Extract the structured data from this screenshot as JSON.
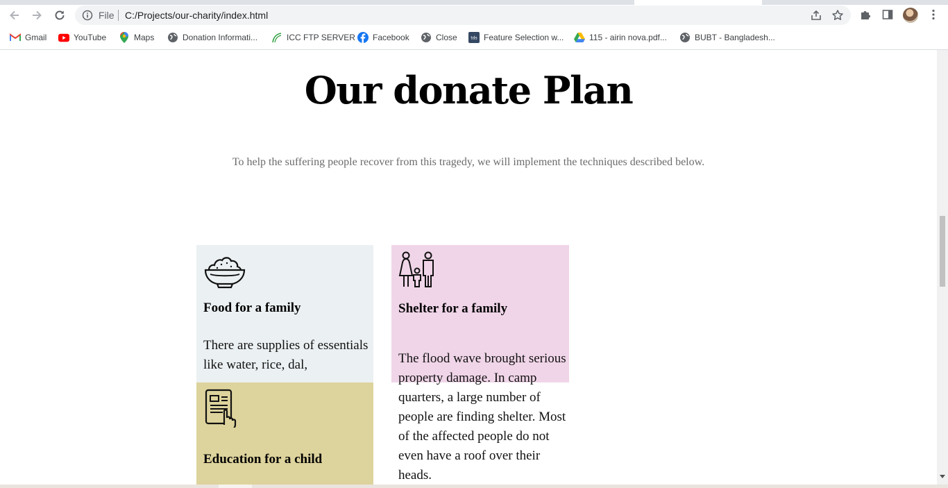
{
  "browser": {
    "url_scheme_label": "File",
    "url": "C:/Projects/our-charity/index.html"
  },
  "bookmarks": [
    {
      "label": "Gmail",
      "icon": "gmail-icon"
    },
    {
      "label": "YouTube",
      "icon": "youtube-icon"
    },
    {
      "label": "Maps",
      "icon": "maps-icon"
    },
    {
      "label": "Donation Informati...",
      "icon": "globe-icon"
    },
    {
      "label": "ICC FTP SERVER",
      "icon": "icc-icon"
    },
    {
      "label": "Facebook",
      "icon": "facebook-icon"
    },
    {
      "label": "Close",
      "icon": "globe-icon"
    },
    {
      "label": "Feature Selection w...",
      "icon": "tds-icon"
    },
    {
      "label": "115 - airin nova.pdf...",
      "icon": "drive-icon"
    },
    {
      "label": "BUBT - Bangladesh...",
      "icon": "globe-icon"
    }
  ],
  "page": {
    "title": "Our donate Plan",
    "subtitle": "To help the suffering people recover from this tragedy, we will implement the techniques described below.",
    "cards": [
      {
        "heading": "Food for a family",
        "text": "There are supplies of essentials like water, rice, dal,",
        "icon": "food-bowl-icon",
        "color": "#ebf0f2"
      },
      {
        "heading": "Shelter for a family",
        "text": "The flood wave brought serious property damage. In camp quarters, a large number of people are finding shelter. Most of the affected people do not even have a roof over their heads.",
        "icon": "family-icon",
        "color": "#f0d5e8"
      },
      {
        "heading": "Education for a child",
        "icon": "education-tablet-icon",
        "color": "#ddd39c"
      }
    ]
  }
}
